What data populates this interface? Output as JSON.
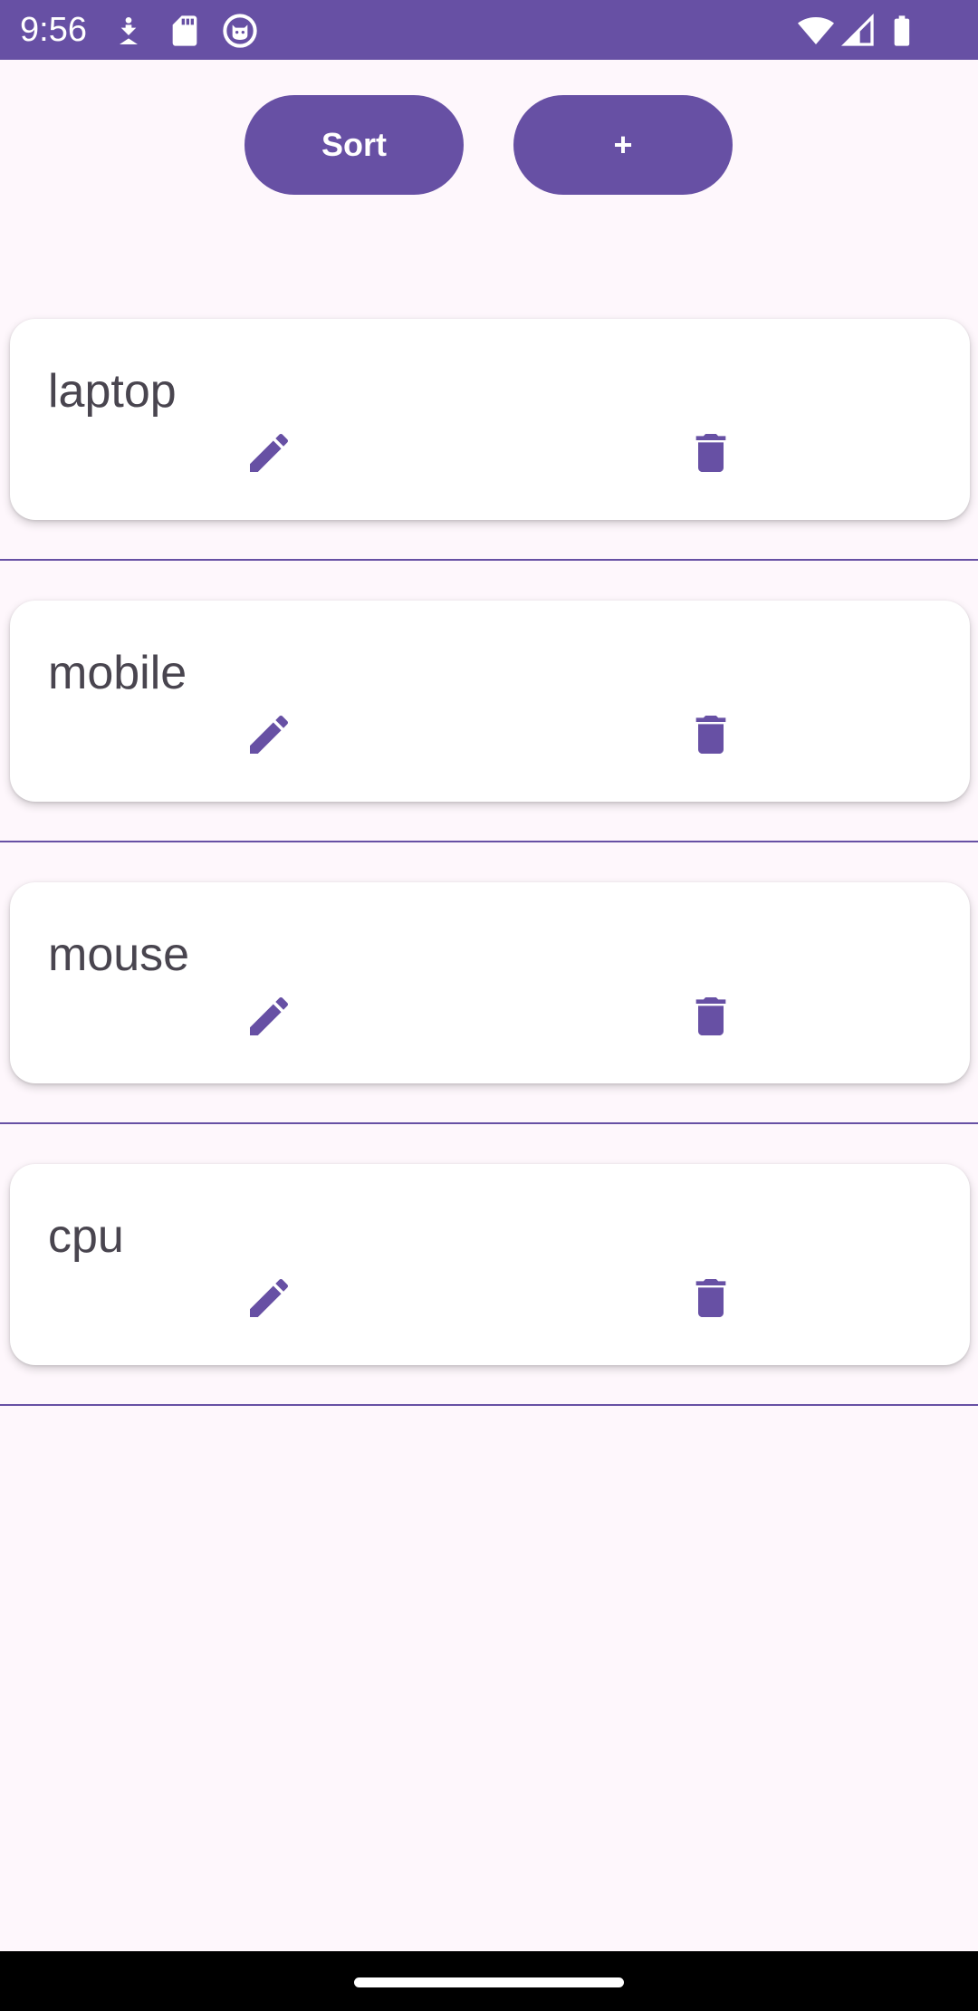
{
  "status_bar": {
    "time": "9:56",
    "icons": [
      "download-icon",
      "sd-card-icon",
      "cat-face-icon",
      "wifi-icon",
      "cell-signal-icon",
      "battery-icon"
    ]
  },
  "toolbar": {
    "sort_label": "Sort",
    "add_label": "+"
  },
  "items": [
    {
      "name": "laptop"
    },
    {
      "name": "mobile"
    },
    {
      "name": "mouse"
    },
    {
      "name": "cpu"
    }
  ],
  "colors": {
    "primary": "#6750A4",
    "background": "#FEF7FC",
    "card": "#FFFFFF",
    "text": "#49454F"
  }
}
